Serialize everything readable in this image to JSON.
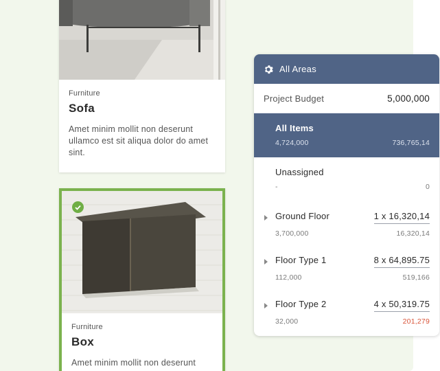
{
  "cards": [
    {
      "category": "Furniture",
      "title": "Sofa",
      "description": "Amet minim mollit non deserunt ullamco est sit aliqua dolor do amet sint.",
      "selected": false
    },
    {
      "category": "Furniture",
      "title": "Box",
      "description": "Amet minim mollit non deserunt",
      "selected": true
    }
  ],
  "panel": {
    "header_title": "All Areas",
    "header_icon": "gear-icon",
    "budget_label": "Project Budget",
    "budget_value": "5,000,000",
    "rows": [
      {
        "name": "All Items",
        "sub": "4,724,000",
        "right": "",
        "right_sub": "736,765,14",
        "selected": true
      },
      {
        "name": "Unassigned",
        "sub": "-",
        "right": "",
        "right_sub": "0",
        "selected": false
      },
      {
        "name": "Ground Floor",
        "sub": "3,700,000",
        "right": "1 x 16,320,14",
        "right_sub": "16,320,14",
        "selected": false
      },
      {
        "name": "Floor Type 1",
        "sub": "112,000",
        "right": "8 x 64,895.75",
        "right_sub": "519,166",
        "selected": false
      },
      {
        "name": "Floor Type 2",
        "sub": "32,000",
        "right": "4 x 50,319.75",
        "right_sub": "201,279",
        "selected": false,
        "over_budget": true
      }
    ]
  },
  "colors": {
    "panel_header": "#506486",
    "selected_border": "#7bb24e",
    "check": "#6fae45",
    "over_budget": "#d9553a",
    "background": "#f2f7ec"
  }
}
